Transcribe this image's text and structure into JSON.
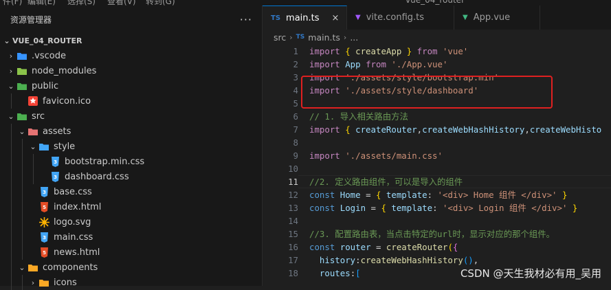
{
  "sidebar": {
    "title": "资源管理器",
    "more_label": "···",
    "section_title": "VUE_04_ROUTER",
    "items": [
      {
        "label": ".vscode",
        "depth": 0,
        "chevron": "right",
        "icon": "vscode-folder-icon",
        "color": "#3794ff"
      },
      {
        "label": "node_modules",
        "depth": 0,
        "chevron": "right",
        "icon": "node-folder-icon",
        "color": "#8bc34a"
      },
      {
        "label": "public",
        "depth": 0,
        "chevron": "down",
        "icon": "public-folder-icon",
        "color": "#4caf50"
      },
      {
        "label": "favicon.ico",
        "depth": 1,
        "chevron": "none",
        "icon": "favicon-star-icon",
        "color": "#f44336"
      },
      {
        "label": "src",
        "depth": 0,
        "chevron": "down",
        "icon": "src-folder-icon",
        "color": "#4caf50"
      },
      {
        "label": "assets",
        "depth": 1,
        "chevron": "down",
        "icon": "assets-folder-icon",
        "color": "#e57373"
      },
      {
        "label": "style",
        "depth": 2,
        "chevron": "down",
        "icon": "style-folder-icon",
        "color": "#42a5f5"
      },
      {
        "label": "bootstrap.min.css",
        "depth": 3,
        "chevron": "none",
        "icon": "css-file-icon",
        "color": "#42a5f5"
      },
      {
        "label": "dashboard.css",
        "depth": 3,
        "chevron": "none",
        "icon": "css-file-icon",
        "color": "#42a5f5"
      },
      {
        "label": "base.css",
        "depth": 2,
        "chevron": "none",
        "icon": "css-file-icon",
        "color": "#42a5f5"
      },
      {
        "label": "index.html",
        "depth": 2,
        "chevron": "none",
        "icon": "html-file-icon",
        "color": "#e44d26"
      },
      {
        "label": "logo.svg",
        "depth": 2,
        "chevron": "none",
        "icon": "svg-file-icon",
        "color": "#ffb300"
      },
      {
        "label": "main.css",
        "depth": 2,
        "chevron": "none",
        "icon": "css-file-icon",
        "color": "#42a5f5"
      },
      {
        "label": "news.html",
        "depth": 2,
        "chevron": "none",
        "icon": "html-file-icon",
        "color": "#e44d26"
      },
      {
        "label": "components",
        "depth": 1,
        "chevron": "down",
        "icon": "components-folder-icon",
        "color": "#f9a825"
      },
      {
        "label": "icons",
        "depth": 2,
        "chevron": "right",
        "icon": "icons-folder-icon",
        "color": "#f9a825"
      }
    ]
  },
  "tabs": [
    {
      "label": "main.ts",
      "icon_text": "TS",
      "icon_color": "#3178c6",
      "active": true,
      "close": "×"
    },
    {
      "label": "vite.config.ts",
      "icon_text": "▼",
      "icon_color": "#a259ff",
      "active": false
    },
    {
      "label": "App.vue",
      "icon_text": "▼",
      "icon_color": "#41b883",
      "active": false
    }
  ],
  "breadcrumb": {
    "folder": "src",
    "file": "main.ts",
    "file_icon": "TS",
    "tail": "..."
  },
  "code": {
    "current_line": 11,
    "lines": [
      {
        "n": 1,
        "tokens": [
          [
            "kw",
            "import "
          ],
          [
            "br",
            "{ "
          ],
          [
            "fn",
            "createApp"
          ],
          [
            "br",
            " }"
          ],
          [
            "kw",
            " from "
          ],
          [
            "st",
            "'vue'"
          ]
        ]
      },
      {
        "n": 2,
        "tokens": [
          [
            "kw",
            "import "
          ],
          [
            "vr",
            "App"
          ],
          [
            "kw",
            " from "
          ],
          [
            "st",
            "'./App.vue'"
          ]
        ]
      },
      {
        "n": 3,
        "tokens": [
          [
            "kw",
            "import "
          ],
          [
            "st",
            "'./assets/style/bootstrap.min'"
          ]
        ]
      },
      {
        "n": 4,
        "tokens": [
          [
            "kw",
            "import "
          ],
          [
            "st",
            "'./assets/style/dashboard'"
          ]
        ]
      },
      {
        "n": 5,
        "tokens": []
      },
      {
        "n": 6,
        "tokens": [
          [
            "cm",
            "// 1. 导入相关路由方法"
          ]
        ]
      },
      {
        "n": 7,
        "tokens": [
          [
            "kw",
            "import "
          ],
          [
            "br",
            "{ "
          ],
          [
            "vr",
            "createRouter"
          ],
          [
            "pu",
            ","
          ],
          [
            "vr",
            "createWebHashHistory"
          ],
          [
            "pu",
            ","
          ],
          [
            "vr",
            "createWebHisto"
          ]
        ]
      },
      {
        "n": 8,
        "tokens": []
      },
      {
        "n": 9,
        "tokens": [
          [
            "kw",
            "import "
          ],
          [
            "st",
            "'./assets/main.css'"
          ]
        ]
      },
      {
        "n": 10,
        "tokens": []
      },
      {
        "n": 11,
        "tokens": [
          [
            "cm",
            "//2. 定义路由组件，可以是导入的组件"
          ]
        ]
      },
      {
        "n": 12,
        "tokens": [
          [
            "kb",
            "const "
          ],
          [
            "vr",
            "Home"
          ],
          [
            "pu",
            " = "
          ],
          [
            "br",
            "{ "
          ],
          [
            "vr",
            "template"
          ],
          [
            "pu",
            ": "
          ],
          [
            "st",
            "'<div> Home 组件 </div>'"
          ],
          [
            "br",
            " }"
          ]
        ]
      },
      {
        "n": 13,
        "tokens": [
          [
            "kb",
            "const "
          ],
          [
            "vr",
            "Login"
          ],
          [
            "pu",
            " = "
          ],
          [
            "br",
            "{ "
          ],
          [
            "vr",
            "template"
          ],
          [
            "pu",
            ": "
          ],
          [
            "st",
            "'<div> Login 组件 </div>'"
          ],
          [
            "br",
            " }"
          ]
        ]
      },
      {
        "n": 14,
        "tokens": []
      },
      {
        "n": 15,
        "tokens": [
          [
            "cm",
            "//3. 配置路由表，当点击特定的url时，显示对应的那个组件。"
          ]
        ]
      },
      {
        "n": 16,
        "tokens": [
          [
            "kb",
            "const "
          ],
          [
            "vr",
            "router"
          ],
          [
            "pu",
            " = "
          ],
          [
            "fn",
            "createRouter"
          ],
          [
            "br",
            "("
          ],
          [
            "br2",
            "{"
          ]
        ]
      },
      {
        "n": 17,
        "tokens": [
          [
            "pu",
            "  "
          ],
          [
            "vr",
            "history"
          ],
          [
            "pu",
            ":"
          ],
          [
            "fn",
            "createWebHashHistory"
          ],
          [
            "br3",
            "()"
          ],
          [
            "pu",
            ","
          ]
        ]
      },
      {
        "n": 18,
        "tokens": [
          [
            "pu",
            "  "
          ],
          [
            "vr",
            "routes"
          ],
          [
            "pu",
            ":"
          ],
          [
            "br3",
            "["
          ]
        ]
      }
    ]
  },
  "watermark": "CSDN @天生我材必有用_吴用",
  "topstrip": [
    "件(F)",
    "编辑(E)",
    "选择(S)",
    "查看(V)",
    "转到(G)",
    "vue_04_router"
  ]
}
